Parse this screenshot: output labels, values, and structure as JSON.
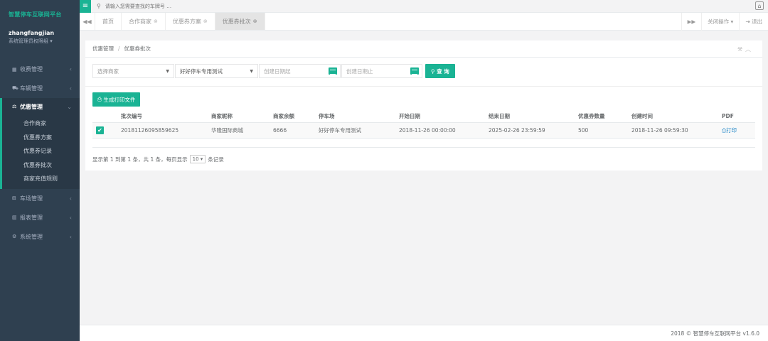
{
  "sidebar": {
    "brand": "智慧停车互联网平台",
    "username": "zhangfangjian",
    "role": "系统管理员权限组 ▾",
    "menu": [
      {
        "label": "收费管理",
        "icon": "grid-icon"
      },
      {
        "label": "车辆管理",
        "icon": "car-icon"
      },
      {
        "label": "优惠管理",
        "icon": "balance-icon",
        "active": true
      },
      {
        "label": "车场管理",
        "icon": "binoculars-icon"
      },
      {
        "label": "报表管理",
        "icon": "bar-chart-icon"
      },
      {
        "label": "系统管理",
        "icon": "gears-icon"
      }
    ],
    "submenu": [
      "合作商家",
      "优惠券方案",
      "优惠券记录",
      "优惠券批次",
      "商家充值规则"
    ]
  },
  "topbar": {
    "search_placeholder": "请输入您需要查找的车牌号 …"
  },
  "tabs": {
    "items": [
      "首页",
      "合作商家",
      "优惠券方案",
      "优惠券批次"
    ],
    "close_ops": "关闭操作",
    "logout": "退出"
  },
  "panel": {
    "breadcrumb_parent": "优惠管理",
    "breadcrumb_sep": "/",
    "breadcrumb_current": "优惠券批次"
  },
  "filters": {
    "merchant_placeholder": "选择商家",
    "parking_value": "好好停车专用测试",
    "date_start_placeholder": "创建日期起",
    "date_end_placeholder": "创建日期止",
    "query_button": "查 询"
  },
  "actions": {
    "generate_print": "生成打印文件"
  },
  "table": {
    "headers": [
      "批次编号",
      "商家昵称",
      "商家余额",
      "停车场",
      "开始日期",
      "结束日期",
      "优惠券数量",
      "创建时间",
      "PDF"
    ],
    "rows": [
      {
        "batch_no": "20181126095859625",
        "merchant": "华隆国际商城",
        "balance": "6666",
        "parking": "好好停车专用测试",
        "start": "2018-11-26 00:00:00",
        "end": "2025-02-26 23:59:59",
        "count": "500",
        "created": "2018-11-26 09:59:30",
        "pdf": "打印"
      }
    ]
  },
  "pager": {
    "info": "显示第 1 到第 1 条，共 1 条，每页显示",
    "page_size": "10",
    "suffix": "条记录"
  },
  "footer": {
    "text": "2018 © 智慧停车互联网平台 v1.6.0"
  }
}
